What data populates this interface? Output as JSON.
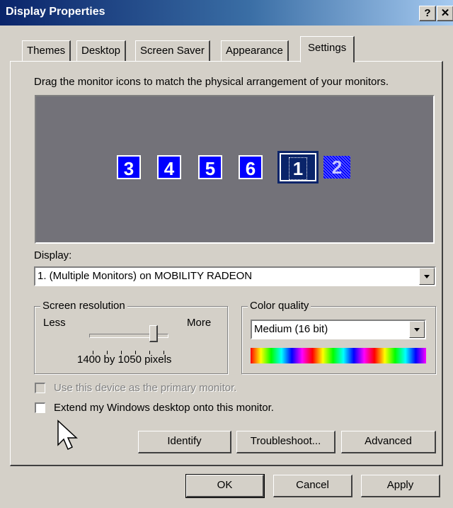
{
  "window": {
    "title": "Display Properties",
    "help_label": "?",
    "close_label": "✕"
  },
  "tabs": [
    {
      "label": "Themes"
    },
    {
      "label": "Desktop"
    },
    {
      "label": "Screen Saver"
    },
    {
      "label": "Appearance"
    },
    {
      "label": "Settings",
      "active": true
    }
  ],
  "settings": {
    "instruction": "Drag the monitor icons to match the physical arrangement of your monitors.",
    "monitors": [
      "3",
      "4",
      "5",
      "6",
      "1",
      "2"
    ],
    "selected_monitor": "1",
    "display_label": "Display:",
    "display_value": "1. (Multiple Monitors) on MOBILITY RADEON",
    "resolution": {
      "title": "Screen resolution",
      "less_label": "Less",
      "more_label": "More",
      "value_text": "1400 by 1050 pixels",
      "slider_fraction": 0.83,
      "tick_count": 6
    },
    "color_quality": {
      "title": "Color quality",
      "value": "Medium (16 bit)"
    },
    "primary_checkbox": {
      "label": "Use this device as the primary monitor.",
      "checked": false,
      "enabled": false
    },
    "extend_checkbox": {
      "label": "Extend my Windows desktop onto this monitor.",
      "checked": false
    },
    "buttons": {
      "identify": "Identify",
      "troubleshoot": "Troubleshoot...",
      "advanced": "Advanced"
    }
  },
  "footer": {
    "ok": "OK",
    "cancel": "Cancel",
    "apply": "Apply"
  },
  "colors": {
    "titlebar_start": "#0a246a",
    "face": "#d4d0c8",
    "monitor_blue": "#0000ff",
    "monitor_area": "#737279"
  }
}
